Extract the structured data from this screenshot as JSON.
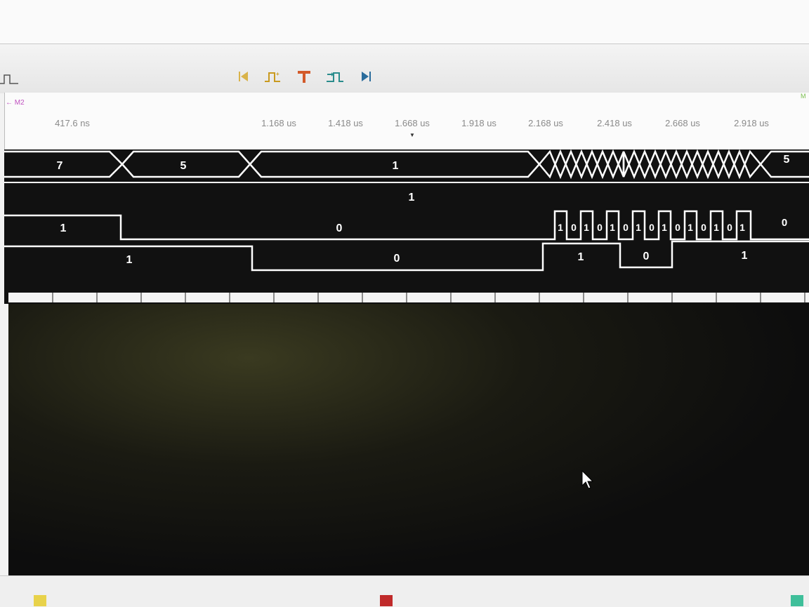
{
  "toolbar": {
    "buttons": [
      {
        "name": "go-to-start",
        "icon": "skip-back-icon"
      },
      {
        "name": "add-edge",
        "icon": "edge-plus-icon"
      },
      {
        "name": "trigger",
        "icon": "trigger-t-icon"
      },
      {
        "name": "next-pulse",
        "icon": "pulse-arrow-icon"
      },
      {
        "name": "go-to-end",
        "icon": "skip-forward-icon"
      }
    ]
  },
  "ruler": {
    "marker": "M2",
    "ticks": [
      "417.6 ns",
      "1.168 us",
      "1.418 us",
      "1.668 us",
      "1.918 us",
      "2.168 us",
      "2.418 us",
      "2.668 us",
      "2.918 us"
    ]
  },
  "waveforms": {
    "bus": {
      "values": [
        "7",
        "5",
        "1",
        "5"
      ]
    },
    "constant": {
      "value": "1"
    },
    "fast_signal": {
      "start": "1",
      "mid": "0",
      "pulses": [
        "1",
        "0",
        "1",
        "0",
        "1",
        "0",
        "1",
        "0",
        "1",
        "0",
        "1",
        "0",
        "1",
        "0",
        "1",
        "0",
        "1"
      ],
      "end": "0"
    },
    "slow_signal": {
      "values": [
        "1",
        "0",
        "1",
        "0",
        "1"
      ]
    }
  },
  "colors": {
    "waveform_bg": "#111111",
    "trace": "#ffffff",
    "tick_text": "#8a8a8a",
    "marker": "#c050c0"
  }
}
